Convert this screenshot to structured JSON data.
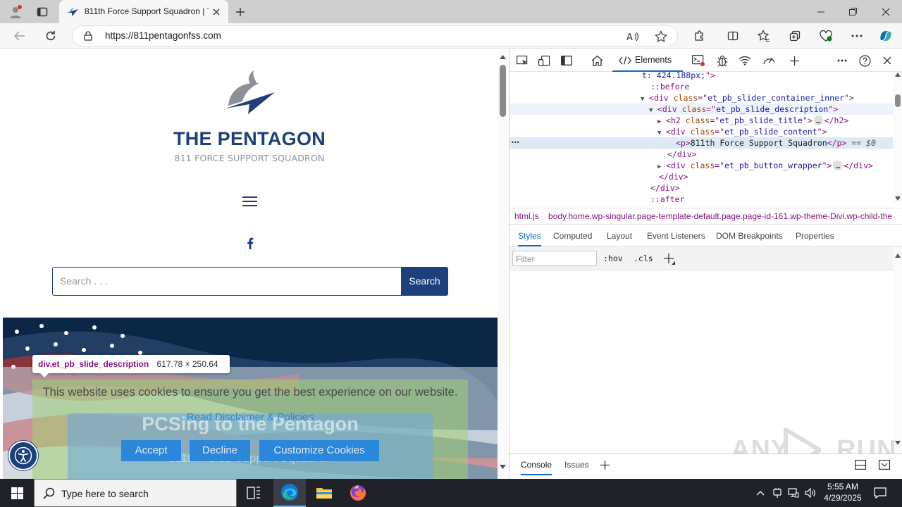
{
  "browser": {
    "tab_title": "811th Force Support Squadron | T",
    "url": "https://811pentagonfss.com"
  },
  "site": {
    "logo_title": "THE PENTAGON",
    "logo_subtitle": "811 FORCE SUPPORT SQUADRON",
    "search_placeholder": "Search . . .",
    "search_button": "Search",
    "hero_title": "PCSing to the Pentagon",
    "hero_subtitle": "811th Force Support Squadron",
    "inspect_tooltip_selector": "div.et_pb_slide_description",
    "inspect_tooltip_size": "617.78 × 250.64",
    "cookie_text": "This website uses cookies to ensure you get the best experience on our website.",
    "cookie_link": "Read Disclaimer & Policies",
    "cookie_accept": "Accept",
    "cookie_decline": "Decline",
    "cookie_customize": "Customize Cookies"
  },
  "devtools": {
    "elements_tab": "Elements",
    "tree": [
      {
        "indent": 188,
        "parts": [
          [
            "val",
            "t: 424.188px;"
          ],
          [
            "tag",
            "\">"
          ]
        ]
      },
      {
        "indent": 200,
        "parts": [
          [
            "pseudo",
            "::before"
          ]
        ]
      },
      {
        "indent": 200,
        "arrow": "▼",
        "parts": [
          [
            "tag",
            "<div "
          ],
          [
            "attr",
            "class"
          ],
          [
            "tag",
            "=\""
          ],
          [
            "val",
            "et_pb_slider_container_inner"
          ],
          [
            "tag",
            "\">"
          ]
        ]
      },
      {
        "indent": 212,
        "arrow": "▼",
        "hl": true,
        "parts": [
          [
            "tag",
            "<div "
          ],
          [
            "attr",
            "class"
          ],
          [
            "tag",
            "=\""
          ],
          [
            "val",
            "et_pb_slide_description"
          ],
          [
            "tag",
            "\">"
          ]
        ]
      },
      {
        "indent": 224,
        "arrow": "▶",
        "parts": [
          [
            "tag",
            "<h2 "
          ],
          [
            "attr",
            "class"
          ],
          [
            "tag",
            "=\""
          ],
          [
            "val",
            "et_pb_slide_title"
          ],
          [
            "tag",
            "\">"
          ],
          [
            "dots",
            "…"
          ],
          [
            "tag",
            "</h2>"
          ]
        ]
      },
      {
        "indent": 224,
        "arrow": "▼",
        "parts": [
          [
            "tag",
            "<div "
          ],
          [
            "attr",
            "class"
          ],
          [
            "tag",
            "=\""
          ],
          [
            "val",
            "et_pb_slide_content"
          ],
          [
            "tag",
            "\">"
          ]
        ]
      },
      {
        "indent": 236,
        "sel": true,
        "parts": [
          [
            "tag",
            "<p>"
          ],
          [
            "text",
            "811th Force Support Squadron"
          ],
          [
            "tag",
            "</p>"
          ],
          [
            "eq",
            " == $0"
          ]
        ]
      },
      {
        "indent": 224,
        "parts": [
          [
            "tag",
            "</div>"
          ]
        ]
      },
      {
        "indent": 224,
        "arrow": "▶",
        "parts": [
          [
            "tag",
            "<div "
          ],
          [
            "attr",
            "class"
          ],
          [
            "tag",
            "=\""
          ],
          [
            "val",
            "et_pb_button_wrapper"
          ],
          [
            "tag",
            "\">"
          ],
          [
            "dots",
            "…"
          ],
          [
            "tag",
            "</div>"
          ]
        ]
      },
      {
        "indent": 212,
        "parts": [
          [
            "tag",
            "</div>"
          ]
        ]
      },
      {
        "indent": 200,
        "parts": [
          [
            "tag",
            "</div>"
          ]
        ]
      },
      {
        "indent": 200,
        "parts": [
          [
            "pseudo",
            "::after"
          ]
        ]
      }
    ],
    "breadcrumb_1": "html.js",
    "breadcrumb_2": "body.home.wp-singular.page-template-default.page.page-id-161.wp-theme-Divi.wp-child-the",
    "panel_tabs": [
      "Styles",
      "Computed",
      "Layout",
      "Event Listeners",
      "DOM Breakpoints",
      "Properties"
    ],
    "filter_placeholder": "Filter",
    "hov": ":hov",
    "cls": ".cls",
    "drawer_tabs": [
      "Console",
      "Issues"
    ]
  },
  "taskbar": {
    "search_placeholder": "Type here to search",
    "time": "5:55 AM",
    "date": "4/29/2025"
  },
  "watermark": "ANY RUN",
  "colors": {
    "brand_navy": "#1d3f7c",
    "accent_blue": "#2b87da",
    "cookie_bg": "#9cc59a",
    "devtools_accent": "#0f6cbd"
  }
}
